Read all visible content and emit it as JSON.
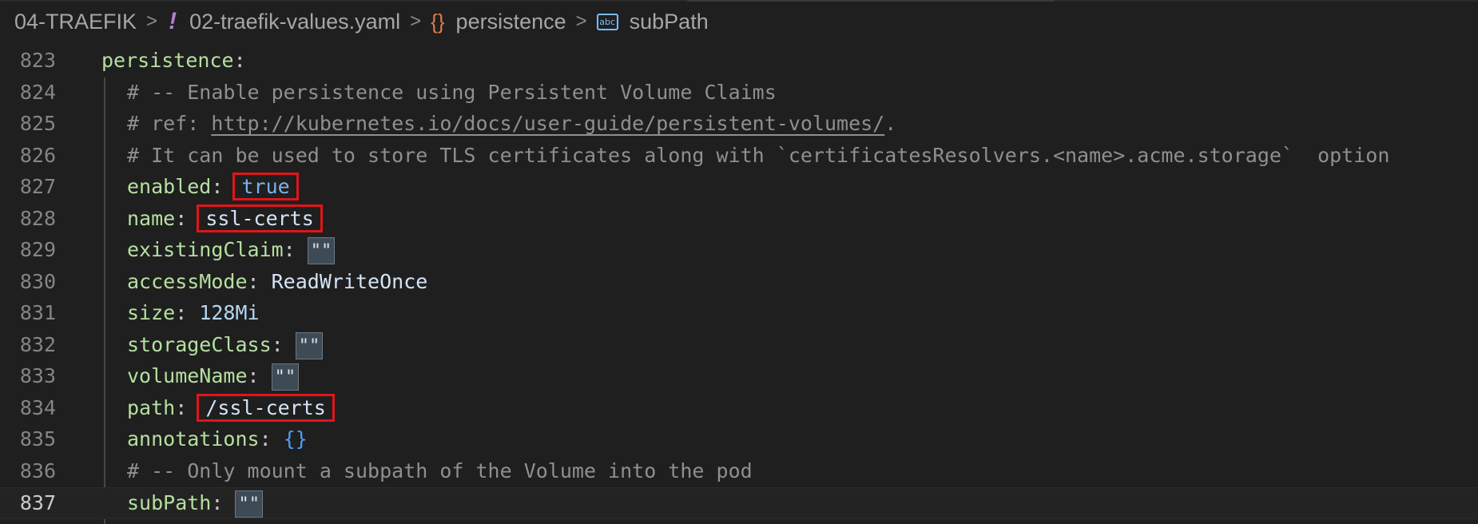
{
  "breadcrumb": {
    "folder": "04-TRAEFIK",
    "file": "02-traefik-values.yaml",
    "file_icon": "!",
    "object_icon": "{}",
    "object": "persistence",
    "field_icon": "abc",
    "field": "subPath"
  },
  "editor": {
    "lines": [
      {
        "num": "823",
        "key": "persistence"
      },
      {
        "num": "824",
        "comment": "# -- Enable persistence using Persistent Volume Claims"
      },
      {
        "num": "825",
        "comment": "# ref: ",
        "url": "http://kubernetes.io/docs/user-guide/persistent-volumes/",
        "suffix": "."
      },
      {
        "num": "826",
        "comment": "# It can be used to store TLS certificates along with `certificatesResolvers.<name>.acme.storage`  option"
      },
      {
        "num": "827",
        "key": "enabled",
        "value": "true",
        "highlighted": true
      },
      {
        "num": "828",
        "key": "name",
        "value": "ssl-certs",
        "highlighted": true
      },
      {
        "num": "829",
        "key": "existingClaim",
        "value": "\"\""
      },
      {
        "num": "830",
        "key": "accessMode",
        "value": "ReadWriteOnce"
      },
      {
        "num": "831",
        "key": "size",
        "value": "128Mi"
      },
      {
        "num": "832",
        "key": "storageClass",
        "value": "\"\""
      },
      {
        "num": "833",
        "key": "volumeName",
        "value": "\"\""
      },
      {
        "num": "834",
        "key": "path",
        "value": "/ssl-certs",
        "highlighted": true
      },
      {
        "num": "835",
        "key": "annotations",
        "value": "{}"
      },
      {
        "num": "836",
        "comment": "# -- Only mount a subpath of the Volume into the pod"
      },
      {
        "num": "837",
        "key": "subPath",
        "value": "\"\"",
        "current": true
      }
    ]
  },
  "colors": {
    "background": "#1f1f1f",
    "key": "#b5e0a0",
    "comment": "#8f8f8f",
    "boolean": "#7ab2e8",
    "highlight_box": "#e0151b"
  }
}
